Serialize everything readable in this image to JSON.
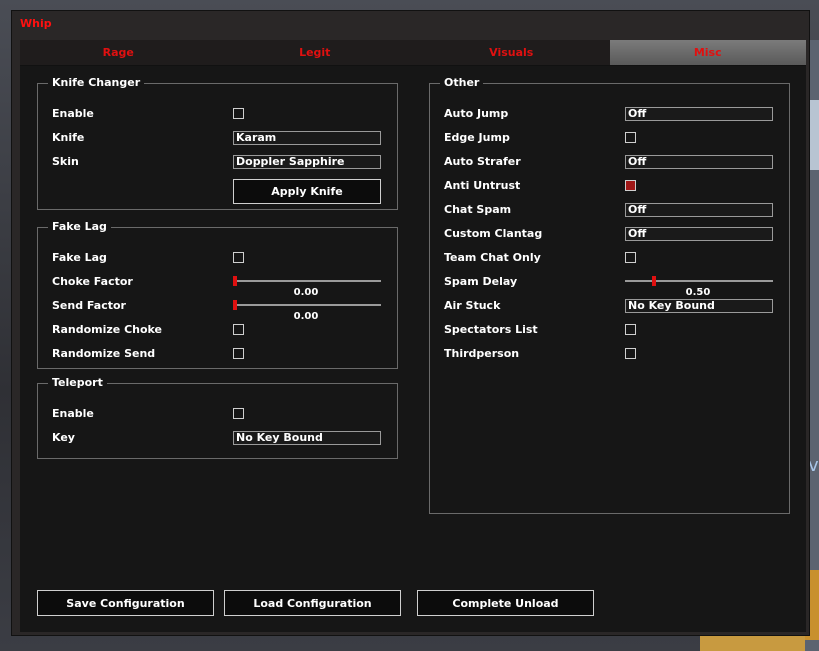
{
  "window": {
    "title": "Whip"
  },
  "tabs": [
    {
      "label": "Rage",
      "active": false
    },
    {
      "label": "Legit",
      "active": false
    },
    {
      "label": "Visuals",
      "active": false
    },
    {
      "label": "Misc",
      "active": true
    }
  ],
  "knife_changer": {
    "title": "Knife Changer",
    "enable_label": "Enable",
    "enable_checked": false,
    "knife_label": "Knife",
    "knife_value": "Karam",
    "skin_label": "Skin",
    "skin_value": "Doppler Sapphire",
    "apply_label": "Apply Knife"
  },
  "fake_lag": {
    "title": "Fake Lag",
    "fake_lag_label": "Fake Lag",
    "fake_lag_checked": false,
    "choke_label": "Choke Factor",
    "choke_value": "0.00",
    "choke_level": 0.0,
    "send_label": "Send Factor",
    "send_value": "0.00",
    "send_level": 0.0,
    "rand_choke_label": "Randomize Choke",
    "rand_choke_checked": false,
    "rand_send_label": "Randomize Send",
    "rand_send_checked": false
  },
  "teleport": {
    "title": "Teleport",
    "enable_label": "Enable",
    "enable_checked": false,
    "key_label": "Key",
    "key_value": "No Key Bound"
  },
  "other": {
    "title": "Other",
    "auto_jump_label": "Auto Jump",
    "auto_jump_value": "Off",
    "edge_jump_label": "Edge Jump",
    "edge_jump_checked": false,
    "auto_strafer_label": "Auto Strafer",
    "auto_strafer_value": "Off",
    "anti_untrust_label": "Anti Untrust",
    "anti_untrust_checked": true,
    "chat_spam_label": "Chat Spam",
    "chat_spam_value": "Off",
    "custom_clantag_label": "Custom Clantag",
    "custom_clantag_value": "Off",
    "team_chat_label": "Team Chat Only",
    "team_chat_checked": false,
    "spam_delay_label": "Spam Delay",
    "spam_delay_value": "0.50",
    "spam_delay_level": 0.18,
    "air_stuck_label": "Air Stuck",
    "air_stuck_value": "No Key Bound",
    "spectators_label": "Spectators List",
    "spectators_checked": false,
    "thirdperson_label": "Thirdperson",
    "thirdperson_checked": false
  },
  "footer": {
    "save_label": "Save Configuration",
    "load_label": "Load Configuration",
    "unload_label": "Complete Unload"
  },
  "colors": {
    "accent": "#e01010",
    "panel": "#161616",
    "frame": "#2a2727",
    "check_on": "#a01818"
  }
}
